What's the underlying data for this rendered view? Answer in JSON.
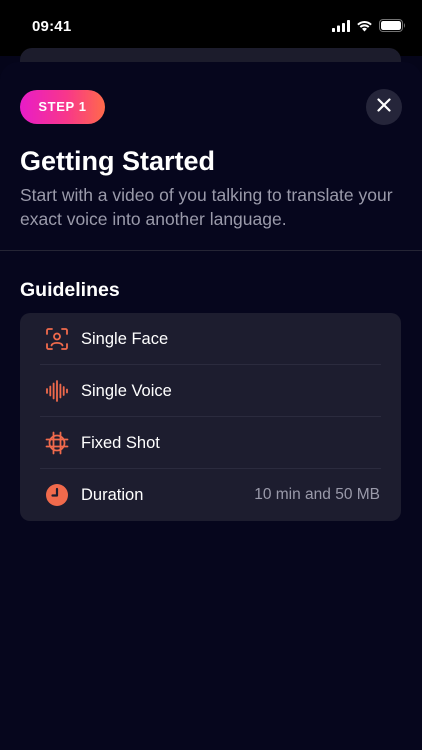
{
  "status_bar": {
    "time": "09:41"
  },
  "sheet": {
    "badge_label": "STEP 1",
    "title": "Getting Started",
    "subtitle": "Start with a video of you talking to translate your exact voice into another language.",
    "close_icon": "close-icon"
  },
  "guidelines": {
    "heading": "Guidelines",
    "items": [
      {
        "label": "Single Face",
        "icon": "face-frame-icon",
        "value": ""
      },
      {
        "label": "Single Voice",
        "icon": "waveform-icon",
        "value": ""
      },
      {
        "label": "Fixed Shot",
        "icon": "crosshair-frame-icon",
        "value": ""
      },
      {
        "label": "Duration",
        "icon": "clock-icon",
        "value": "10 min and 50 MB"
      }
    ]
  },
  "colors": {
    "accent": "#f06a4c",
    "badge_gradient_start": "#e81cc8",
    "badge_gradient_end": "#ff6a4a",
    "sheet_background": "#06061d",
    "card_background": "#1d1d2f",
    "muted_text": "#9a9aaa"
  }
}
